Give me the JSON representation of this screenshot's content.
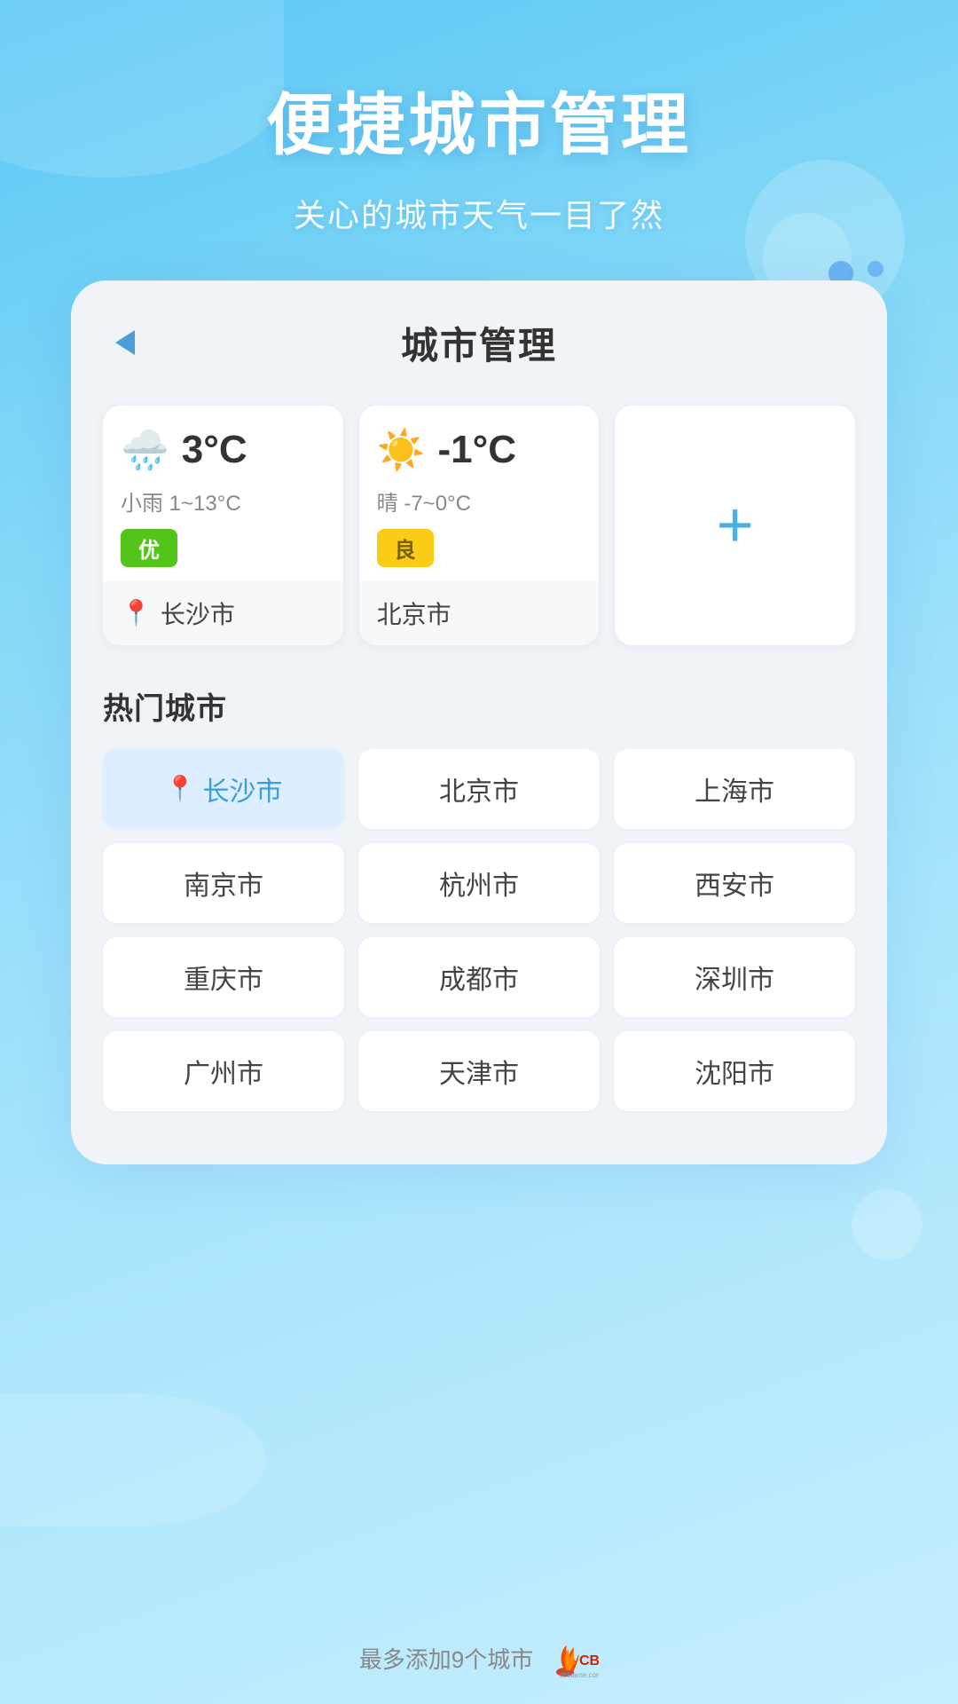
{
  "header": {
    "main_title": "便捷城市管理",
    "sub_title": "关心的城市天气一目了然"
  },
  "card": {
    "title": "城市管理",
    "back_label": "返回"
  },
  "weather_cities": [
    {
      "temp": "3°C",
      "icon": "🌧️",
      "desc": "小雨  1~13°C",
      "air_quality": "优",
      "air_type": "good",
      "city": "长沙市",
      "has_location": true
    },
    {
      "temp": "-1°C",
      "icon": "☀️",
      "desc": "晴  -7~0°C",
      "air_quality": "良",
      "air_type": "fair",
      "city": "北京市",
      "has_location": false
    }
  ],
  "add_city": {
    "label": "添加城市",
    "icon": "+"
  },
  "hot_cities_section": {
    "title": "热门城市",
    "cities": [
      {
        "name": "长沙市",
        "active": true
      },
      {
        "name": "北京市",
        "active": false
      },
      {
        "name": "上海市",
        "active": false
      },
      {
        "name": "南京市",
        "active": false
      },
      {
        "name": "杭州市",
        "active": false
      },
      {
        "name": "西安市",
        "active": false
      },
      {
        "name": "重庆市",
        "active": false
      },
      {
        "name": "成都市",
        "active": false
      },
      {
        "name": "深圳市",
        "active": false
      },
      {
        "name": "广州市",
        "active": false
      },
      {
        "name": "天津市",
        "active": false
      },
      {
        "name": "沈阳市",
        "active": false
      }
    ]
  },
  "footer": {
    "max_cities_text": "最多添加9个城市",
    "watermark": "cbigame.com"
  }
}
